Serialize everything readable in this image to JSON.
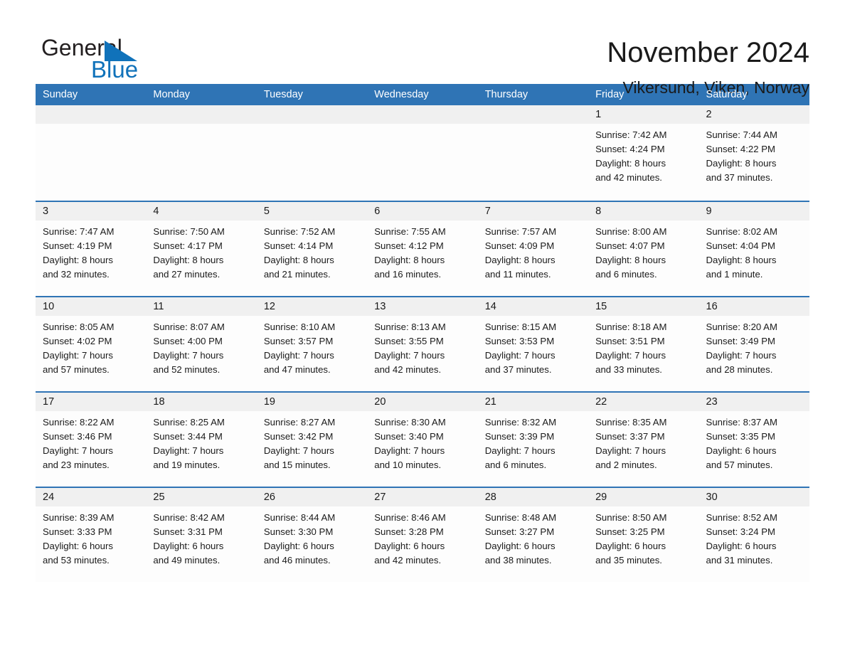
{
  "brand": {
    "name_part1": "General",
    "name_part2": "Blue",
    "accent_color": "#1072ba",
    "header_color": "#2f74b5"
  },
  "header": {
    "month_title": "November 2024",
    "location": "Vikersund, Viken, Norway"
  },
  "weekdays": [
    "Sunday",
    "Monday",
    "Tuesday",
    "Wednesday",
    "Thursday",
    "Friday",
    "Saturday"
  ],
  "weeks": [
    [
      {
        "day": "",
        "sunrise": "",
        "sunset": "",
        "daylight1": "",
        "daylight2": ""
      },
      {
        "day": "",
        "sunrise": "",
        "sunset": "",
        "daylight1": "",
        "daylight2": ""
      },
      {
        "day": "",
        "sunrise": "",
        "sunset": "",
        "daylight1": "",
        "daylight2": ""
      },
      {
        "day": "",
        "sunrise": "",
        "sunset": "",
        "daylight1": "",
        "daylight2": ""
      },
      {
        "day": "",
        "sunrise": "",
        "sunset": "",
        "daylight1": "",
        "daylight2": ""
      },
      {
        "day": "1",
        "sunrise": "Sunrise: 7:42 AM",
        "sunset": "Sunset: 4:24 PM",
        "daylight1": "Daylight: 8 hours",
        "daylight2": "and 42 minutes."
      },
      {
        "day": "2",
        "sunrise": "Sunrise: 7:44 AM",
        "sunset": "Sunset: 4:22 PM",
        "daylight1": "Daylight: 8 hours",
        "daylight2": "and 37 minutes."
      }
    ],
    [
      {
        "day": "3",
        "sunrise": "Sunrise: 7:47 AM",
        "sunset": "Sunset: 4:19 PM",
        "daylight1": "Daylight: 8 hours",
        "daylight2": "and 32 minutes."
      },
      {
        "day": "4",
        "sunrise": "Sunrise: 7:50 AM",
        "sunset": "Sunset: 4:17 PM",
        "daylight1": "Daylight: 8 hours",
        "daylight2": "and 27 minutes."
      },
      {
        "day": "5",
        "sunrise": "Sunrise: 7:52 AM",
        "sunset": "Sunset: 4:14 PM",
        "daylight1": "Daylight: 8 hours",
        "daylight2": "and 21 minutes."
      },
      {
        "day": "6",
        "sunrise": "Sunrise: 7:55 AM",
        "sunset": "Sunset: 4:12 PM",
        "daylight1": "Daylight: 8 hours",
        "daylight2": "and 16 minutes."
      },
      {
        "day": "7",
        "sunrise": "Sunrise: 7:57 AM",
        "sunset": "Sunset: 4:09 PM",
        "daylight1": "Daylight: 8 hours",
        "daylight2": "and 11 minutes."
      },
      {
        "day": "8",
        "sunrise": "Sunrise: 8:00 AM",
        "sunset": "Sunset: 4:07 PM",
        "daylight1": "Daylight: 8 hours",
        "daylight2": "and 6 minutes."
      },
      {
        "day": "9",
        "sunrise": "Sunrise: 8:02 AM",
        "sunset": "Sunset: 4:04 PM",
        "daylight1": "Daylight: 8 hours",
        "daylight2": "and 1 minute."
      }
    ],
    [
      {
        "day": "10",
        "sunrise": "Sunrise: 8:05 AM",
        "sunset": "Sunset: 4:02 PM",
        "daylight1": "Daylight: 7 hours",
        "daylight2": "and 57 minutes."
      },
      {
        "day": "11",
        "sunrise": "Sunrise: 8:07 AM",
        "sunset": "Sunset: 4:00 PM",
        "daylight1": "Daylight: 7 hours",
        "daylight2": "and 52 minutes."
      },
      {
        "day": "12",
        "sunrise": "Sunrise: 8:10 AM",
        "sunset": "Sunset: 3:57 PM",
        "daylight1": "Daylight: 7 hours",
        "daylight2": "and 47 minutes."
      },
      {
        "day": "13",
        "sunrise": "Sunrise: 8:13 AM",
        "sunset": "Sunset: 3:55 PM",
        "daylight1": "Daylight: 7 hours",
        "daylight2": "and 42 minutes."
      },
      {
        "day": "14",
        "sunrise": "Sunrise: 8:15 AM",
        "sunset": "Sunset: 3:53 PM",
        "daylight1": "Daylight: 7 hours",
        "daylight2": "and 37 minutes."
      },
      {
        "day": "15",
        "sunrise": "Sunrise: 8:18 AM",
        "sunset": "Sunset: 3:51 PM",
        "daylight1": "Daylight: 7 hours",
        "daylight2": "and 33 minutes."
      },
      {
        "day": "16",
        "sunrise": "Sunrise: 8:20 AM",
        "sunset": "Sunset: 3:49 PM",
        "daylight1": "Daylight: 7 hours",
        "daylight2": "and 28 minutes."
      }
    ],
    [
      {
        "day": "17",
        "sunrise": "Sunrise: 8:22 AM",
        "sunset": "Sunset: 3:46 PM",
        "daylight1": "Daylight: 7 hours",
        "daylight2": "and 23 minutes."
      },
      {
        "day": "18",
        "sunrise": "Sunrise: 8:25 AM",
        "sunset": "Sunset: 3:44 PM",
        "daylight1": "Daylight: 7 hours",
        "daylight2": "and 19 minutes."
      },
      {
        "day": "19",
        "sunrise": "Sunrise: 8:27 AM",
        "sunset": "Sunset: 3:42 PM",
        "daylight1": "Daylight: 7 hours",
        "daylight2": "and 15 minutes."
      },
      {
        "day": "20",
        "sunrise": "Sunrise: 8:30 AM",
        "sunset": "Sunset: 3:40 PM",
        "daylight1": "Daylight: 7 hours",
        "daylight2": "and 10 minutes."
      },
      {
        "day": "21",
        "sunrise": "Sunrise: 8:32 AM",
        "sunset": "Sunset: 3:39 PM",
        "daylight1": "Daylight: 7 hours",
        "daylight2": "and 6 minutes."
      },
      {
        "day": "22",
        "sunrise": "Sunrise: 8:35 AM",
        "sunset": "Sunset: 3:37 PM",
        "daylight1": "Daylight: 7 hours",
        "daylight2": "and 2 minutes."
      },
      {
        "day": "23",
        "sunrise": "Sunrise: 8:37 AM",
        "sunset": "Sunset: 3:35 PM",
        "daylight1": "Daylight: 6 hours",
        "daylight2": "and 57 minutes."
      }
    ],
    [
      {
        "day": "24",
        "sunrise": "Sunrise: 8:39 AM",
        "sunset": "Sunset: 3:33 PM",
        "daylight1": "Daylight: 6 hours",
        "daylight2": "and 53 minutes."
      },
      {
        "day": "25",
        "sunrise": "Sunrise: 8:42 AM",
        "sunset": "Sunset: 3:31 PM",
        "daylight1": "Daylight: 6 hours",
        "daylight2": "and 49 minutes."
      },
      {
        "day": "26",
        "sunrise": "Sunrise: 8:44 AM",
        "sunset": "Sunset: 3:30 PM",
        "daylight1": "Daylight: 6 hours",
        "daylight2": "and 46 minutes."
      },
      {
        "day": "27",
        "sunrise": "Sunrise: 8:46 AM",
        "sunset": "Sunset: 3:28 PM",
        "daylight1": "Daylight: 6 hours",
        "daylight2": "and 42 minutes."
      },
      {
        "day": "28",
        "sunrise": "Sunrise: 8:48 AM",
        "sunset": "Sunset: 3:27 PM",
        "daylight1": "Daylight: 6 hours",
        "daylight2": "and 38 minutes."
      },
      {
        "day": "29",
        "sunrise": "Sunrise: 8:50 AM",
        "sunset": "Sunset: 3:25 PM",
        "daylight1": "Daylight: 6 hours",
        "daylight2": "and 35 minutes."
      },
      {
        "day": "30",
        "sunrise": "Sunrise: 8:52 AM",
        "sunset": "Sunset: 3:24 PM",
        "daylight1": "Daylight: 6 hours",
        "daylight2": "and 31 minutes."
      }
    ]
  ]
}
